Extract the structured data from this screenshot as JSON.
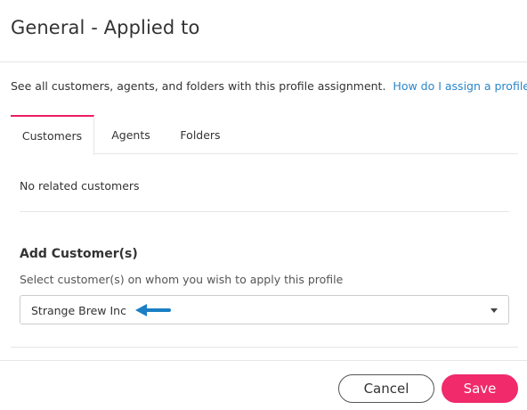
{
  "dialog": {
    "title": "General - Applied to"
  },
  "description": {
    "text": "See all customers, agents, and folders with this profile assignment.",
    "help_link": "How do I assign a profile?"
  },
  "tabs": [
    {
      "label": "Customers",
      "active": true
    },
    {
      "label": "Agents",
      "active": false
    },
    {
      "label": "Folders",
      "active": false
    }
  ],
  "customers_panel": {
    "empty_text": "No related customers",
    "add_title": "Add Customer(s)",
    "add_subtitle": "Select customer(s) on whom you wish to apply this profile",
    "select_value": "Strange Brew Inc"
  },
  "footer": {
    "cancel_label": "Cancel",
    "save_label": "Save"
  },
  "colors": {
    "accent": "#f02a6b",
    "link": "#2a86c9",
    "annotation_arrow": "#1a7fc4"
  }
}
